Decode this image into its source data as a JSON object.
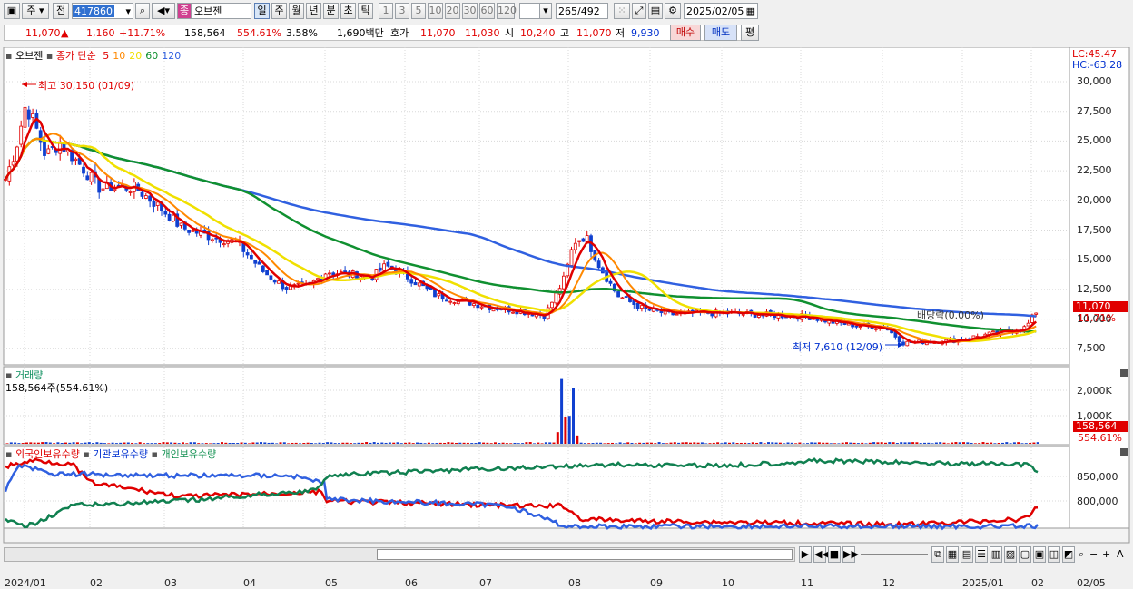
{
  "toolbar": {
    "period_type": "주",
    "compare": "전",
    "code": "417860",
    "name": "오브젠",
    "period_buttons": [
      "일",
      "주",
      "월",
      "년",
      "분",
      "초",
      "틱"
    ],
    "selected_period": "일",
    "interval_buttons": [
      "1",
      "3",
      "5",
      "10",
      "20",
      "30",
      "60",
      "120"
    ],
    "count_current": "265",
    "count_total": "/492",
    "date": "2025/02/05"
  },
  "quote": {
    "price": "11,070",
    "change": "1,160",
    "change_pct": "+11.71%",
    "volume": "158,564",
    "volume_pct": "554.61%",
    "turnover": "3.58%",
    "amount": "1,690백만",
    "bid_label": "호가",
    "bid1": "11,070",
    "bid2": "11,030",
    "open_label": "시",
    "open": "10,240",
    "high_label": "고",
    "high": "11,070",
    "low_label": "저",
    "low": "9,930",
    "buy_label": "매수",
    "sell_label": "매도",
    "eval_label": "평"
  },
  "price_panel": {
    "name": "오브젠",
    "ma_label": "종가 단순",
    "ma_periods": [
      "5",
      "10",
      "20",
      "60",
      "120"
    ],
    "ma_colors": [
      "#e00000",
      "#ff8800",
      "#f0e000",
      "#109030",
      "#3060e0"
    ],
    "lc": "LC:45.47",
    "hc": "HC:-63.28",
    "high_note": "최고 30,150 (01/09)",
    "low_note": "최저 7,610 (12/09)",
    "dividend_note": "배당락(0.00%)",
    "last_price": "11,070",
    "last_pct": "11.71%",
    "y_ticks": [
      "30,000",
      "27,500",
      "25,000",
      "22,500",
      "20,000",
      "17,500",
      "15,000",
      "12,500",
      "10,000",
      "7,500"
    ]
  },
  "volume_panel": {
    "title": "거래량",
    "summary": "158,564주(554.61%)",
    "y_ticks": [
      "2,000K",
      "1,000K"
    ],
    "last_volume": "158,564",
    "last_pct": "554.61%"
  },
  "holdings_panel": {
    "foreign": "외국인보유수량",
    "institution": "기관보유수량",
    "individual": "개인보유수량",
    "y_ticks": [
      "850,000",
      "800,000"
    ]
  },
  "x_axis": {
    "labels": [
      "2024/01",
      "02",
      "03",
      "04",
      "05",
      "06",
      "07",
      "08",
      "09",
      "10",
      "11",
      "12",
      "2025/01",
      "02",
      "02/05"
    ]
  }
}
